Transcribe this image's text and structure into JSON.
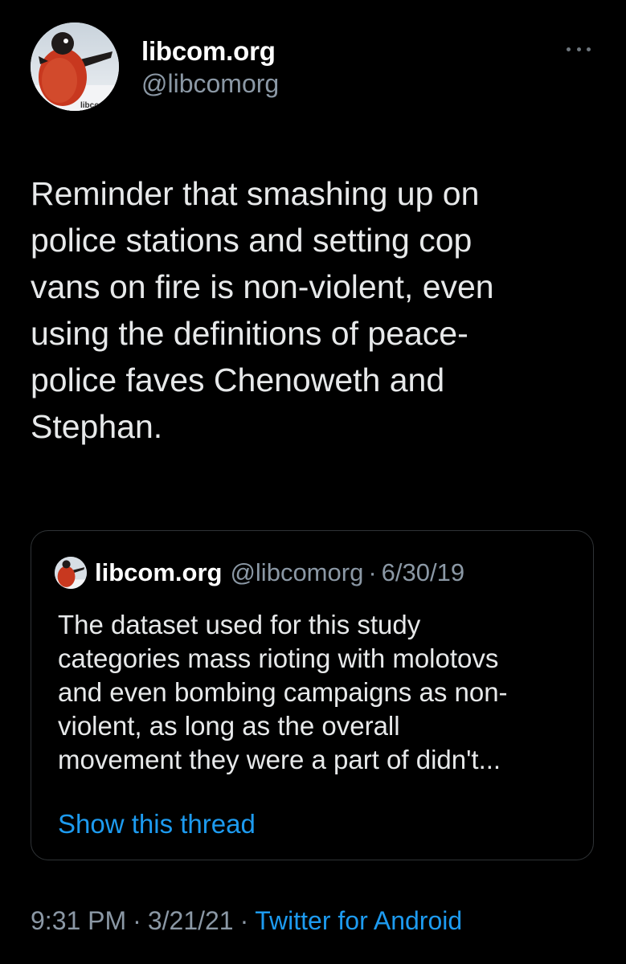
{
  "author": {
    "display_name": "libcom.org",
    "handle": "@libcomorg",
    "avatar_watermark": "libcom"
  },
  "more_icon": "more-dots-icon",
  "tweet": {
    "text": "Reminder that smashing up on\npolice stations and setting cop\nvans on fire is non-violent, even\nusing the definitions of peace-\npolice faves Chenoweth and\nStephan."
  },
  "quote": {
    "display_name": "libcom.org",
    "handle": "@libcomorg",
    "separator": "·",
    "date": "6/30/19",
    "text": "The dataset used for this study\ncategories mass rioting with molotovs\nand even bombing campaigns as non-\nviolent, as long as the overall\nmovement they were a part of didn't...",
    "show_thread": "Show this thread"
  },
  "meta": {
    "time": "9:31 PM",
    "separator": "·",
    "date": "3/21/21",
    "source": "Twitter for Android"
  },
  "colors": {
    "background": "#000000",
    "text": "#e7e9ea",
    "secondary": "#8b98a5",
    "link": "#1d9bf0",
    "border": "#2f3336"
  }
}
